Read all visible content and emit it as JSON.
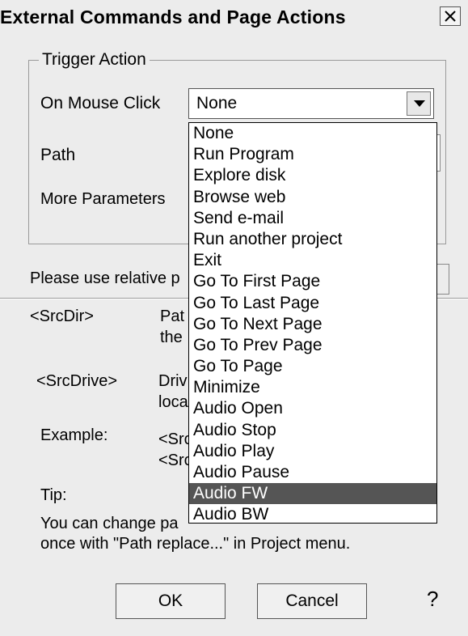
{
  "window": {
    "title": "External Commands and Page Actions",
    "close_glyph": "✕"
  },
  "trigger": {
    "legend": "Trigger Action",
    "mouse_click_label": "On Mouse Click",
    "path_label": "Path",
    "more_params_label": "More Parameters",
    "selected_value": "None"
  },
  "notes": {
    "relative_prefix": "Please use relative p",
    "srcdir_token": "<SrcDir>",
    "srcdir_desc_1": "Pat",
    "srcdir_desc_2": "the",
    "srcdrive_token": "<SrcDrive>",
    "srcdrive_desc_1": "Driv",
    "srcdrive_desc_2": "loca",
    "example_label": "Example:",
    "example_1": "<Src",
    "example_2": "<Src",
    "tip_label": "Tip:",
    "tip_line1": "You can change pa",
    "tip_line2": "once with \"Path replace...\" in Project menu."
  },
  "dropdown": {
    "items": [
      "None",
      "Run Program",
      "Explore disk",
      "Browse web",
      "Send e-mail",
      "Run another project",
      "Exit",
      "Go To First Page",
      "Go To Last Page",
      "Go To Next Page",
      "Go To Prev Page",
      "Go To Page",
      "Minimize",
      "Audio Open",
      "Audio Stop",
      "Audio Play",
      "Audio Pause",
      "Audio FW",
      "Audio BW"
    ],
    "highlighted": "Audio FW"
  },
  "buttons": {
    "ok": "OK",
    "cancel": "Cancel",
    "help_glyph": "?"
  }
}
